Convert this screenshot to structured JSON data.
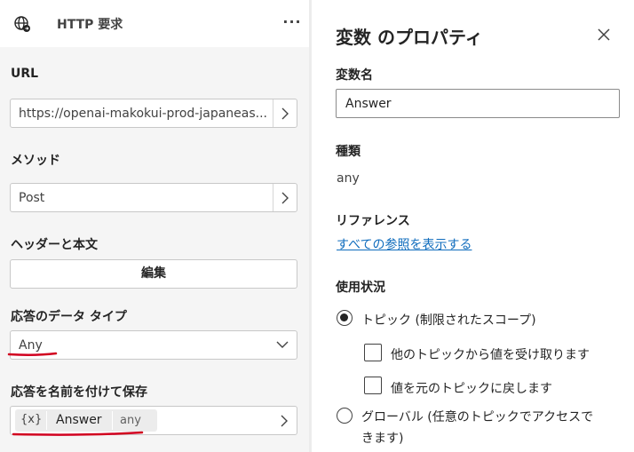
{
  "node": {
    "title": "HTTP 要求",
    "more_label": "···",
    "url_label": "URL",
    "url_value": "https://openai-makokui-prod-japaneas...",
    "method_label": "メソッド",
    "method_value": "Post",
    "headers_label": "ヘッダーと本文",
    "edit_button": "編集",
    "response_type_label": "応答のデータ タイプ",
    "response_type_value": "Any",
    "save_response_label": "応答を名前を付けて保存",
    "variable": {
      "icon_text": "{x}",
      "name": "Answer",
      "type": "any"
    }
  },
  "annotations": {
    "underline_color": "#d1001f"
  },
  "properties": {
    "title": "変数 のプロパティ",
    "name_label": "変数名",
    "name_value": "Answer",
    "type_label": "種類",
    "type_value": "any",
    "reference_label": "リファレンス",
    "reference_link": "すべての参照を表示する",
    "usage_label": "使用状況",
    "scope_options": [
      {
        "label": "トピック (制限されたスコープ)",
        "selected": true
      },
      {
        "label_line1": "グローバル (任意のトピックでアクセスで",
        "label_line2": "きます)",
        "selected": false
      }
    ],
    "topic_checkboxes": [
      {
        "label": "他のトピックから値を受け取ります",
        "checked": false
      },
      {
        "label": "値を元のトピックに戻します",
        "checked": false
      }
    ]
  }
}
